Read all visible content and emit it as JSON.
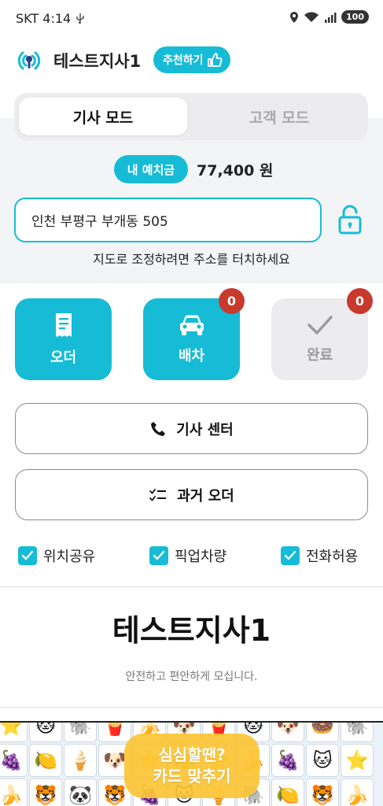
{
  "status_bar": {
    "carrier_time": "SKT 4:14",
    "battery": "100"
  },
  "header": {
    "company_name": "테스트지사1",
    "recommend_label": "추천하기"
  },
  "mode_switch": {
    "driver_mode": "기사 모드",
    "customer_mode": "고객 모드",
    "active": "driver_mode"
  },
  "deposit": {
    "label": "내 예치금",
    "amount": "77,400 원"
  },
  "address": {
    "value": "인천 부평구 부개동 505",
    "hint": "지도로 조정하려면 주소를 터치하세요"
  },
  "tiles": [
    {
      "label": "오더",
      "icon": "receipt-icon"
    },
    {
      "label": "배차",
      "icon": "car-icon",
      "badge": "0"
    },
    {
      "label": "완료",
      "icon": "check-icon",
      "badge": "0"
    }
  ],
  "buttons": {
    "driver_center": "기사 센터",
    "past_orders": "과거 오더"
  },
  "checks": [
    {
      "label": "위치공유",
      "checked": true
    },
    {
      "label": "픽업차량",
      "checked": true
    },
    {
      "label": "전화허용",
      "checked": true
    }
  ],
  "footer": {
    "title": "테스트지사1",
    "subtitle": "안전하고 편안하게 모십니다."
  },
  "banner": {
    "line1": "심심할땐?",
    "line2": "카드 맞추기"
  },
  "colors": {
    "accent": "#16bcd6",
    "badge": "#c83a2e",
    "banner_cta": "#fcc434"
  }
}
